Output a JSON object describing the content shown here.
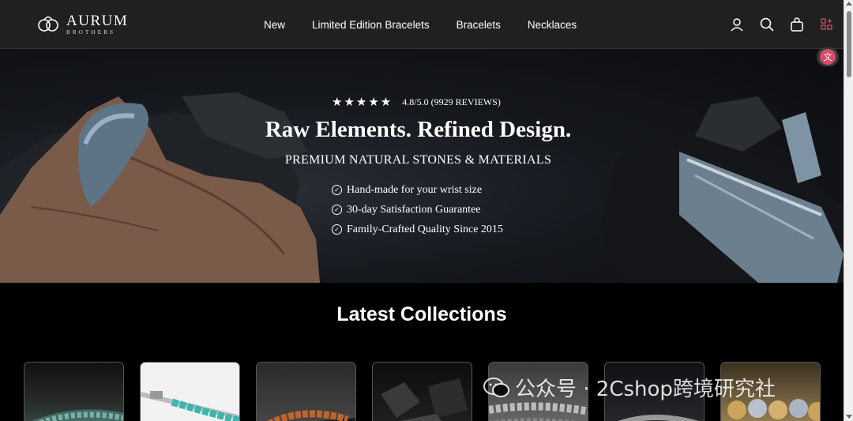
{
  "brand": {
    "name": "AURUM",
    "sub": "BROTHERS"
  },
  "nav": {
    "items": [
      {
        "label": "New"
      },
      {
        "label": "Limited Edition Bracelets"
      },
      {
        "label": "Bracelets"
      },
      {
        "label": "Necklaces"
      }
    ]
  },
  "hero": {
    "stars": "★★★★★",
    "rating_text": "4.8/5.0 (9929 REVIEWS)",
    "rating_value": 4.8,
    "title": "Raw Elements. Refined Design.",
    "subtitle": "PREMIUM NATURAL STONES & MATERIALS",
    "features": [
      "Hand-made for your wrist size",
      "30-day Satisfaction Guarantee",
      "Family-Crafted Quality Since 2015"
    ]
  },
  "collections": {
    "title": "Latest Collections",
    "cards": [
      {
        "name": "collection-1",
        "color": "#3c4f4a"
      },
      {
        "name": "collection-2",
        "color": "#e8e8e8"
      },
      {
        "name": "collection-3",
        "color": "#3a3a3a"
      },
      {
        "name": "collection-4",
        "color": "#1b1b1b"
      },
      {
        "name": "collection-5",
        "color": "#6e6e6e"
      },
      {
        "name": "collection-6",
        "color": "#1d1f22"
      },
      {
        "name": "collection-7",
        "color": "#a48a5a"
      }
    ]
  },
  "watermark": {
    "text": "公众号 · 2Cshop跨境研究社"
  },
  "colors": {
    "header_bg": "#202020",
    "accent": "#d64b6a",
    "background": "#000000"
  }
}
